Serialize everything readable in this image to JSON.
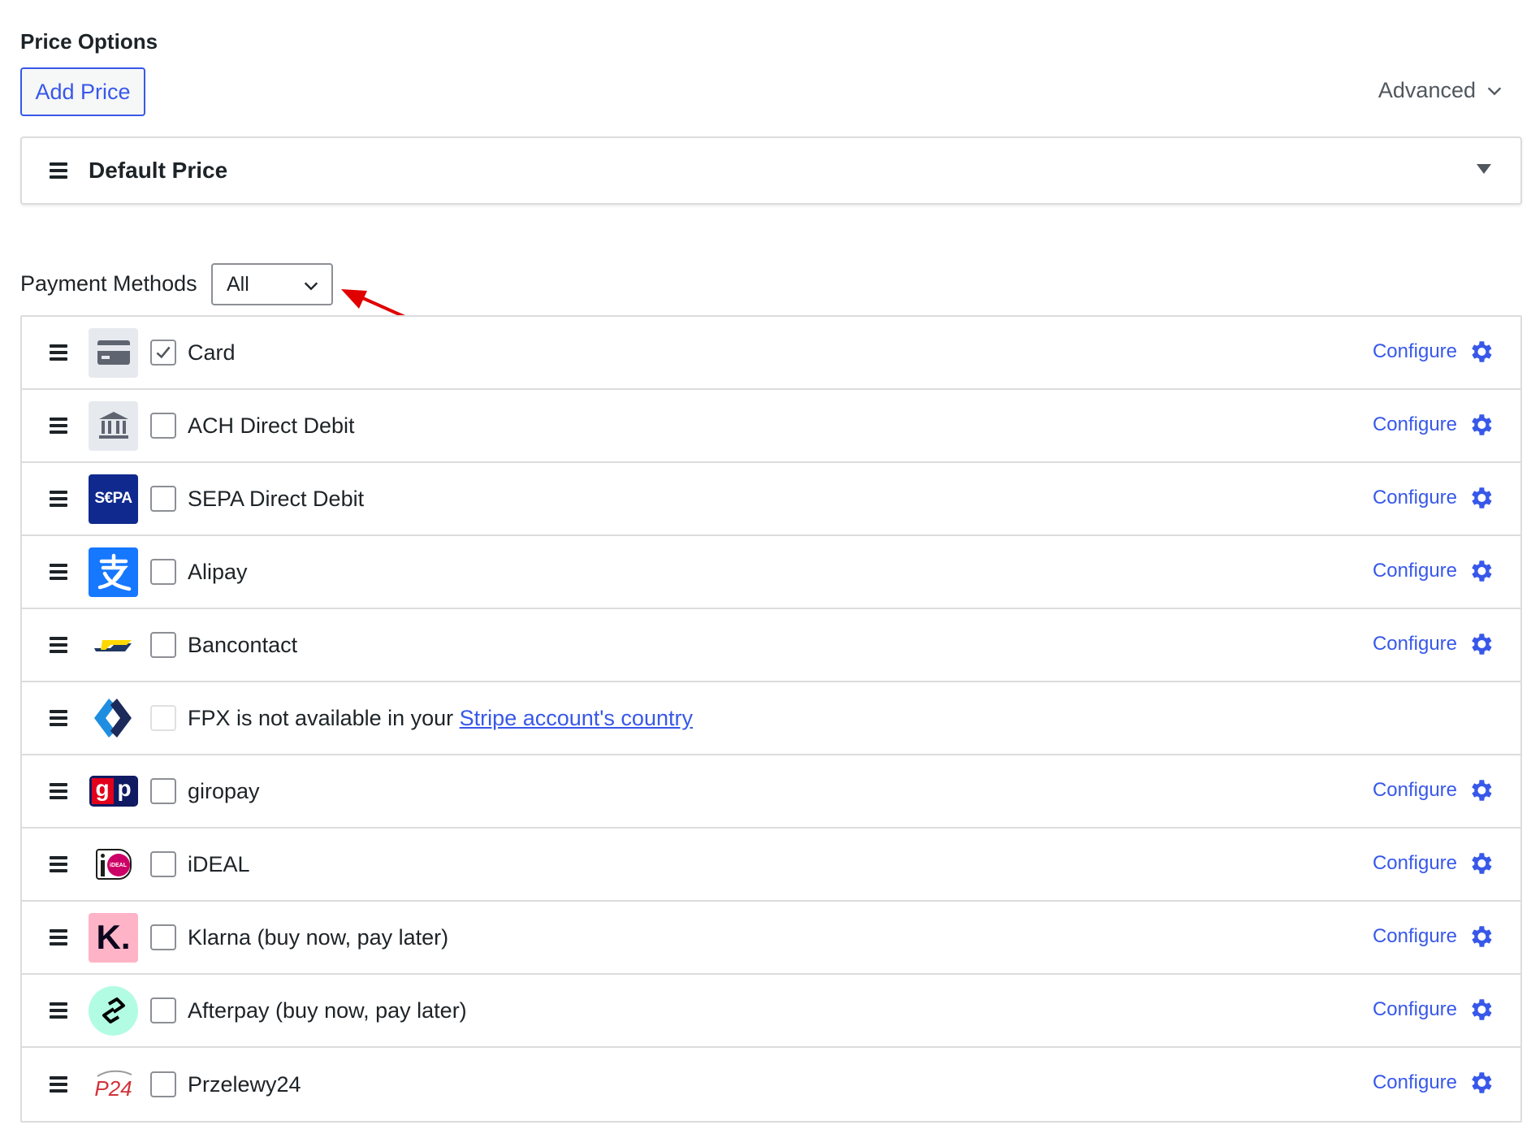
{
  "price_options": {
    "title": "Price Options",
    "add_price_label": "Add Price",
    "advanced_label": "Advanced",
    "default_price_title": "Default Price"
  },
  "payment_methods": {
    "label": "Payment Methods",
    "filter_selected": "All",
    "configure_label": "Configure",
    "items": [
      {
        "name": "Card",
        "checked": true,
        "logo": "card-icon"
      },
      {
        "name": "ACH Direct Debit",
        "checked": false,
        "logo": "bank-icon"
      },
      {
        "name": "SEPA Direct Debit",
        "checked": false,
        "logo": "sepa-logo",
        "logo_text": "S€PA"
      },
      {
        "name": "Alipay",
        "checked": false,
        "logo": "alipay-logo"
      },
      {
        "name": "Bancontact",
        "checked": false,
        "logo": "bancontact-logo"
      },
      {
        "name": "FPX is not available in your ",
        "link": "Stripe account's country",
        "checked": false,
        "disabled": true,
        "logo": "fpx-logo"
      },
      {
        "name": "giropay",
        "checked": false,
        "logo": "giropay-logo",
        "logo_text_g": "g",
        "logo_text_p": "p"
      },
      {
        "name": "iDEAL",
        "checked": false,
        "logo": "ideal-logo",
        "logo_text": "iDEAL"
      },
      {
        "name": "Klarna (buy now, pay later)",
        "checked": false,
        "logo": "klarna-logo",
        "logo_text": "K."
      },
      {
        "name": "Afterpay (buy now, pay later)",
        "checked": false,
        "logo": "afterpay-logo"
      },
      {
        "name": "Przelewy24",
        "checked": false,
        "logo": "przelewy24-logo",
        "logo_text": "P24"
      }
    ]
  },
  "colors": {
    "accent": "#3858e9",
    "annotation_arrow": "#e00000"
  }
}
